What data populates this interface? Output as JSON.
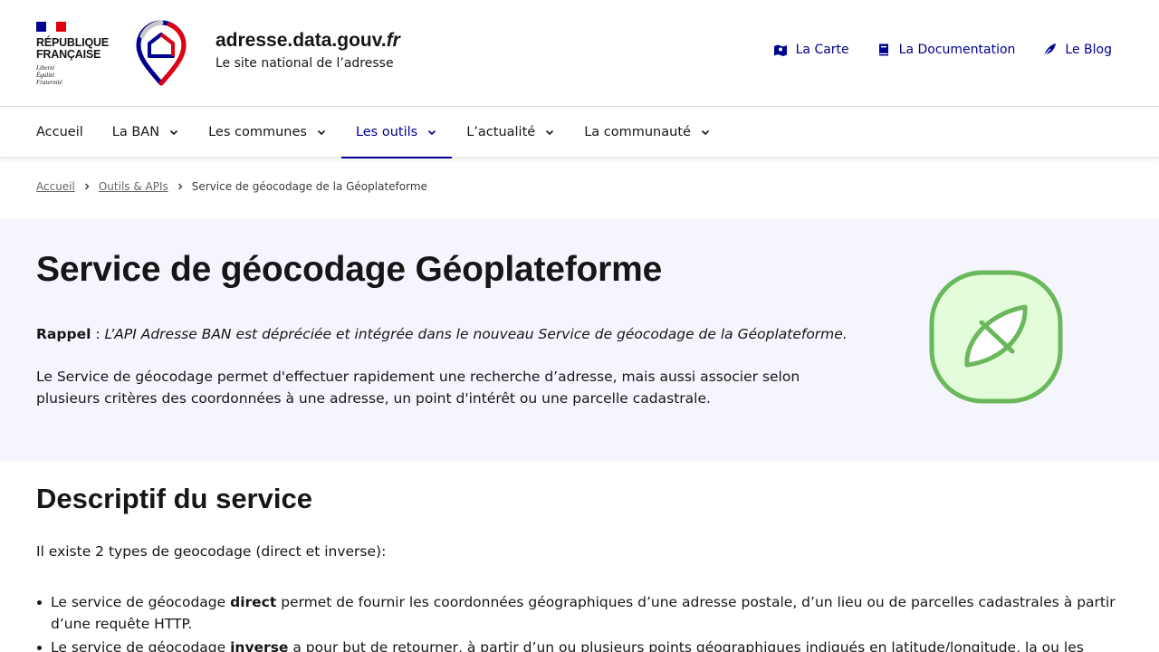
{
  "header": {
    "republic": {
      "line1": "RÉPUBLIQUE",
      "line2": "FRANÇAISE",
      "motto1": "Liberté",
      "motto2": "Égalité",
      "motto3": "Fraternité"
    },
    "site_name_main": "adresse.data.gouv.",
    "site_name_suffix": "fr",
    "tagline": "Le site national de l’adresse",
    "quick_links": [
      {
        "label": "La Carte",
        "icon": "map-icon"
      },
      {
        "label": "La Documentation",
        "icon": "book-icon"
      },
      {
        "label": "Le Blog",
        "icon": "feather-icon"
      }
    ],
    "colors": {
      "blue_france": "#000091",
      "red_marianne": "#e1000f"
    }
  },
  "nav": {
    "items": [
      {
        "label": "Accueil",
        "has_dropdown": false,
        "active": false
      },
      {
        "label": "La BAN",
        "has_dropdown": true,
        "active": false
      },
      {
        "label": "Les communes",
        "has_dropdown": true,
        "active": false
      },
      {
        "label": "Les outils",
        "has_dropdown": true,
        "active": true
      },
      {
        "label": "L’actualité",
        "has_dropdown": true,
        "active": false
      },
      {
        "label": "La communauté",
        "has_dropdown": true,
        "active": false
      }
    ]
  },
  "breadcrumb": {
    "items": [
      "Accueil",
      "Outils & APIs"
    ],
    "current": "Service de géocodage de la Géoplateforme"
  },
  "hero": {
    "title": "Service de géocodage Géoplateforme",
    "reminder_label": "Rappel",
    "reminder_sep": " : ",
    "reminder_text": "L’API Adresse BAN est dépréciée et intégrée dans le nouveau Service de géocodage de la Géoplateforme.",
    "description": "Le Service de géocodage permet d'effectuer rapidement une recherche d’adresse, mais aussi associer selon plusieurs critères des coordonnées à une adresse, un point d'intérêt ou une parcelle cadastrale.",
    "illustration_icon": "leaf-icon",
    "background": "#f5f5fe"
  },
  "section": {
    "title": "Descriptif du service",
    "intro": "Il existe 2 types de geocodage (direct et inverse):",
    "list": [
      {
        "prefix": "Le service de géocodage ",
        "bold": "direct",
        "text": " permet de fournir les coordonnées géographiques d’une adresse postale, d’un lieu ou de parcelles cadastrales à partir d’une requête HTTP."
      },
      {
        "prefix": "Le service de géocodage ",
        "bold": "inverse",
        "text": " a pour but de retourner, à partir d’un ou plusieurs points géographiques indiqués en latitude/longitude, la ou les entités"
      }
    ]
  }
}
